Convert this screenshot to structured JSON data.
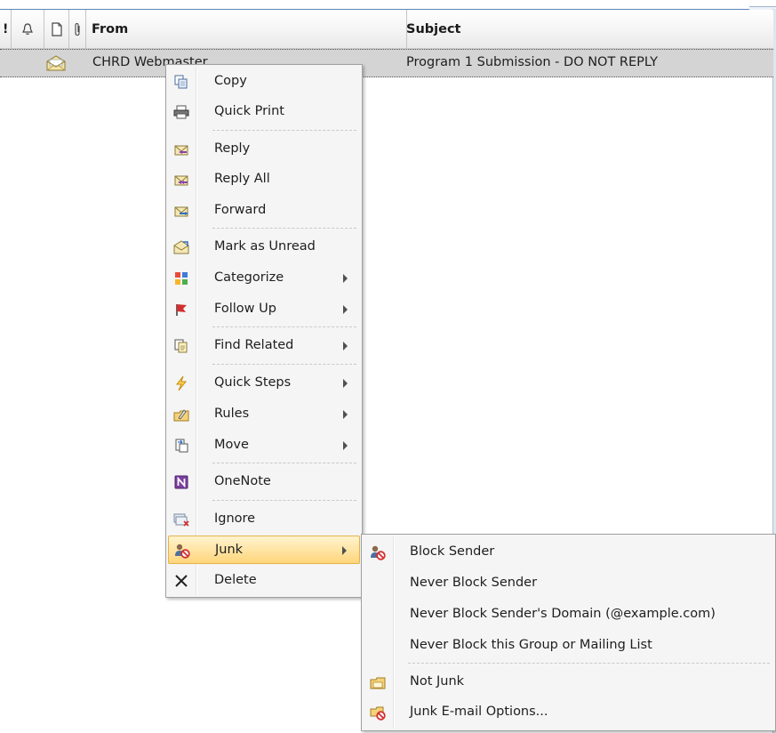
{
  "columns": {
    "importance_icon": "importance-icon",
    "reminder_icon": "bell-icon",
    "type_icon": "document-icon",
    "attachment_icon": "paperclip-icon",
    "from": "From",
    "subject": "Subject"
  },
  "message": {
    "icon": "open-envelope-icon",
    "from": "CHRD Webmaster",
    "subject": "Program 1 Submission - DO NOT REPLY"
  },
  "context_menu": {
    "items": [
      {
        "label": "Copy",
        "icon": "copy-icon"
      },
      {
        "label": "Quick Print",
        "icon": "printer-icon"
      },
      {
        "label": "Reply",
        "icon": "reply-icon"
      },
      {
        "label": "Reply All",
        "icon": "reply-all-icon"
      },
      {
        "label": "Forward",
        "icon": "forward-icon"
      },
      {
        "label": "Mark as Unread",
        "icon": "mark-unread-icon"
      },
      {
        "label": "Categorize",
        "icon": "categorize-icon",
        "submenu": true
      },
      {
        "label": "Follow Up",
        "icon": "flag-icon",
        "submenu": true
      },
      {
        "label": "Find Related",
        "icon": "find-related-icon",
        "submenu": true
      },
      {
        "label": "Quick Steps",
        "icon": "lightning-icon",
        "submenu": true
      },
      {
        "label": "Rules",
        "icon": "rules-icon",
        "submenu": true
      },
      {
        "label": "Move",
        "icon": "move-icon",
        "submenu": true
      },
      {
        "label": "OneNote",
        "icon": "onenote-icon"
      },
      {
        "label": "Ignore",
        "icon": "ignore-icon"
      },
      {
        "label": "Junk",
        "icon": "junk-icon",
        "submenu": true,
        "highlighted": true
      },
      {
        "label": "Delete",
        "icon": "delete-x-icon"
      }
    ]
  },
  "junk_submenu": {
    "items": [
      {
        "label": "Block Sender",
        "icon": "block-sender-icon"
      },
      {
        "label": "Never Block Sender"
      },
      {
        "label": "Never Block Sender's Domain (@example.com)"
      },
      {
        "label": "Never Block this Group or Mailing List"
      },
      {
        "label": "Not Junk",
        "icon": "not-junk-icon"
      },
      {
        "label": "Junk E-mail Options...",
        "icon": "junk-options-icon"
      }
    ]
  },
  "colors": {
    "highlight_top": "#fff3cf",
    "highlight_bottom": "#ffd67b",
    "selected_row": "#d4d4d4",
    "menu_bg": "#f5f5f5"
  }
}
